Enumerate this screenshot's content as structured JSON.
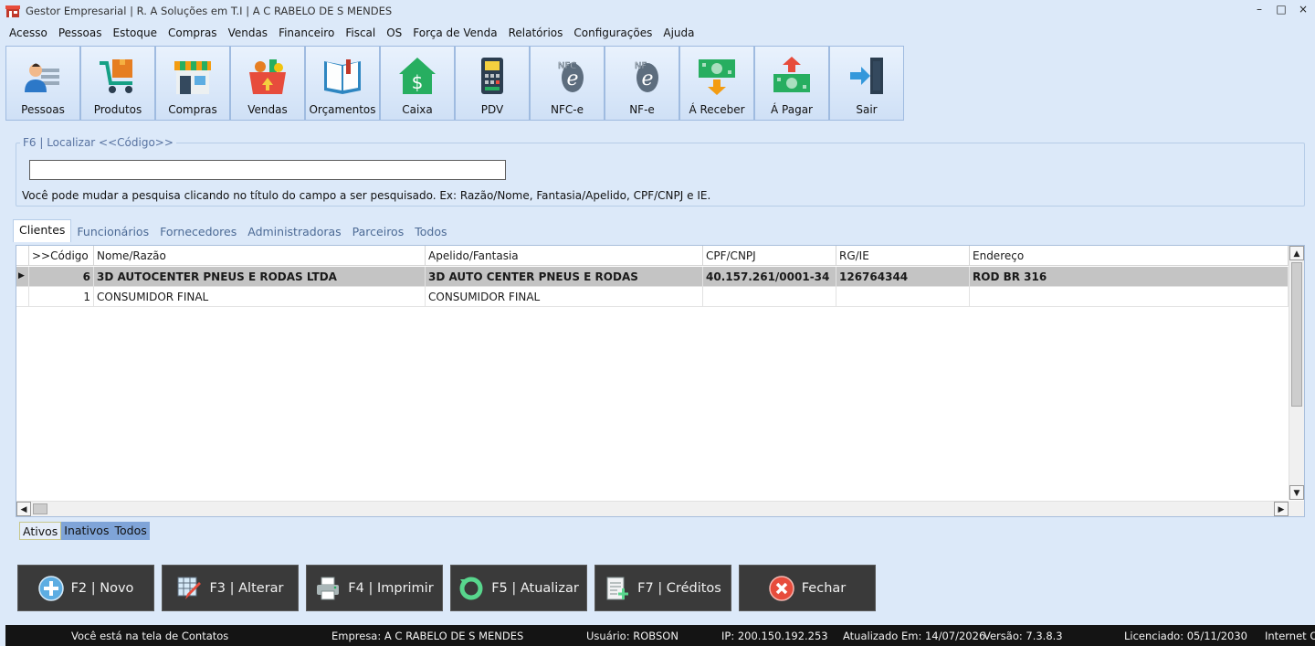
{
  "window": {
    "title": "Gestor Empresarial | R. A Soluções em T.I | A C RABELO DE S MENDES",
    "controls": [
      "–",
      "□",
      "×"
    ]
  },
  "menu": [
    "Acesso",
    "Pessoas",
    "Estoque",
    "Compras",
    "Vendas",
    "Financeiro",
    "Fiscal",
    "OS",
    "Força de Venda",
    "Relatórios",
    "Configurações",
    "Ajuda"
  ],
  "toolbar": [
    {
      "label": "Pessoas",
      "icon": "person-icon"
    },
    {
      "label": "Produtos",
      "icon": "cart-icon"
    },
    {
      "label": "Compras",
      "icon": "store-icon"
    },
    {
      "label": "Vendas",
      "icon": "basket-icon"
    },
    {
      "label": "Orçamentos",
      "icon": "book-icon"
    },
    {
      "label": "Caixa",
      "icon": "money-house-icon"
    },
    {
      "label": "PDV",
      "icon": "pos-terminal-icon"
    },
    {
      "label": "NFC-e",
      "icon": "nfce-icon"
    },
    {
      "label": "NF-e",
      "icon": "nfe-icon"
    },
    {
      "label": "Á Receber",
      "icon": "receive-money-icon"
    },
    {
      "label": "Á Pagar",
      "icon": "pay-money-icon"
    },
    {
      "label": "Sair",
      "icon": "exit-icon"
    }
  ],
  "search": {
    "legend": "F6 | Localizar <<Código>>",
    "value": "",
    "hint": "Você pode mudar a pesquisa clicando no título do campo a ser pesquisado. Ex: Razão/Nome, Fantasia/Apelido, CPF/CNPJ e IE."
  },
  "tabs": [
    "Clientes",
    "Funcionários",
    "Fornecedores",
    "Administradoras",
    "Parceiros",
    "Todos"
  ],
  "grid": {
    "columns": [
      "",
      ">>Código",
      "Nome/Razão",
      "Apelido/Fantasia",
      "CPF/CNPJ",
      "RG/IE",
      "Endereço"
    ],
    "rows": [
      {
        "marker": "▶",
        "codigo": "6",
        "nome": "3D AUTOCENTER PNEUS E RODAS LTDA",
        "apelido": "3D AUTO CENTER PNEUS E RODAS",
        "cpf": "40.157.261/0001-34",
        "rg": "126764344",
        "endereco": "ROD BR 316"
      },
      {
        "marker": "",
        "codigo": "1",
        "nome": "CONSUMIDOR FINAL",
        "apelido": "CONSUMIDOR FINAL",
        "cpf": "",
        "rg": "",
        "endereco": ""
      }
    ]
  },
  "filters": [
    "Ativos",
    "Inativos",
    "Todos"
  ],
  "actions": [
    {
      "label": "F2 | Novo",
      "icon": "plus-circle-icon"
    },
    {
      "label": "F3 | Alterar",
      "icon": "edit-icon"
    },
    {
      "label": "F4 | Imprimir",
      "icon": "printer-icon"
    },
    {
      "label": "F5 | Atualizar",
      "icon": "refresh-icon"
    },
    {
      "label": "F7 | Créditos",
      "icon": "add-document-icon"
    },
    {
      "label": "Fechar",
      "icon": "close-circle-icon"
    }
  ],
  "status": {
    "screen": "Você está na tela de Contatos",
    "empresa": "Empresa: A C RABELO DE S MENDES",
    "usuario": "Usuário: ROBSON",
    "ip": "IP: 200.150.192.253",
    "atualizado": "Atualizado Em: 14/07/2026",
    "versao": "Versão: 7.3.8.3",
    "licenciado": "Licenciado: 05/11/2030",
    "internet": "Internet O"
  }
}
